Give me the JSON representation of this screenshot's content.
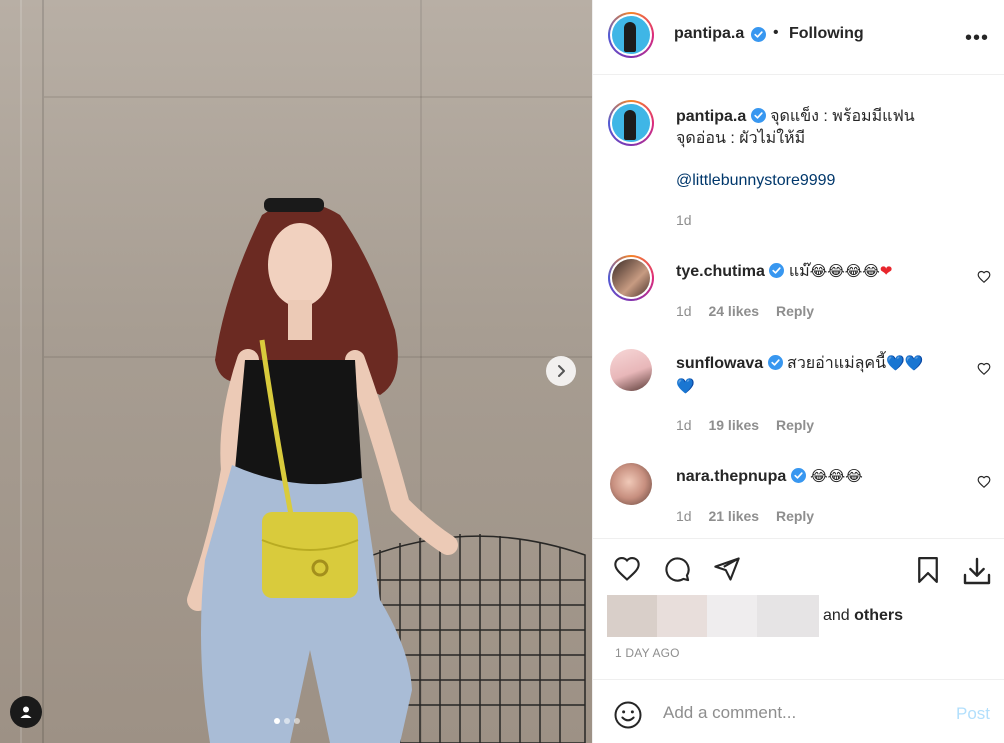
{
  "post": {
    "username": "pantipa.a",
    "follow_label": "Following",
    "bullet": "•",
    "more_label": "•••",
    "caption_line1": "จุดแข็ง : พร้อมมีแฟน",
    "caption_line2": "จุดอ่อน : ผัวไม่ให้มี",
    "mention": "@littlebunnystore9999",
    "caption_time": "1d"
  },
  "comments": [
    {
      "username": "tye.chutima",
      "text": "แม๊",
      "emoji": "😂😂😂😂",
      "emoji_end": "❤",
      "time": "1d",
      "likes": "24 likes",
      "reply": "Reply"
    },
    {
      "username": "sunflowava",
      "text": "สวยอ่าแม่ลุคนี้",
      "emoji": "💙💙",
      "emoji_line2": "💙",
      "time": "1d",
      "likes": "19 likes",
      "reply": "Reply"
    },
    {
      "username": "nara.thepnupa",
      "text": "",
      "emoji": "😂😂😂",
      "time": "1d",
      "likes": "21 likes",
      "reply": "Reply"
    }
  ],
  "likes": {
    "and_text": "and",
    "others_text": "others"
  },
  "post_age": "1 DAY AGO",
  "add_comment": {
    "placeholder": "Add a comment...",
    "post_label": "Post"
  },
  "colors": {
    "accent": "#0095f6",
    "post_disabled": "#b2dffc",
    "mention": "#00376b",
    "verified": "#3897f0"
  }
}
